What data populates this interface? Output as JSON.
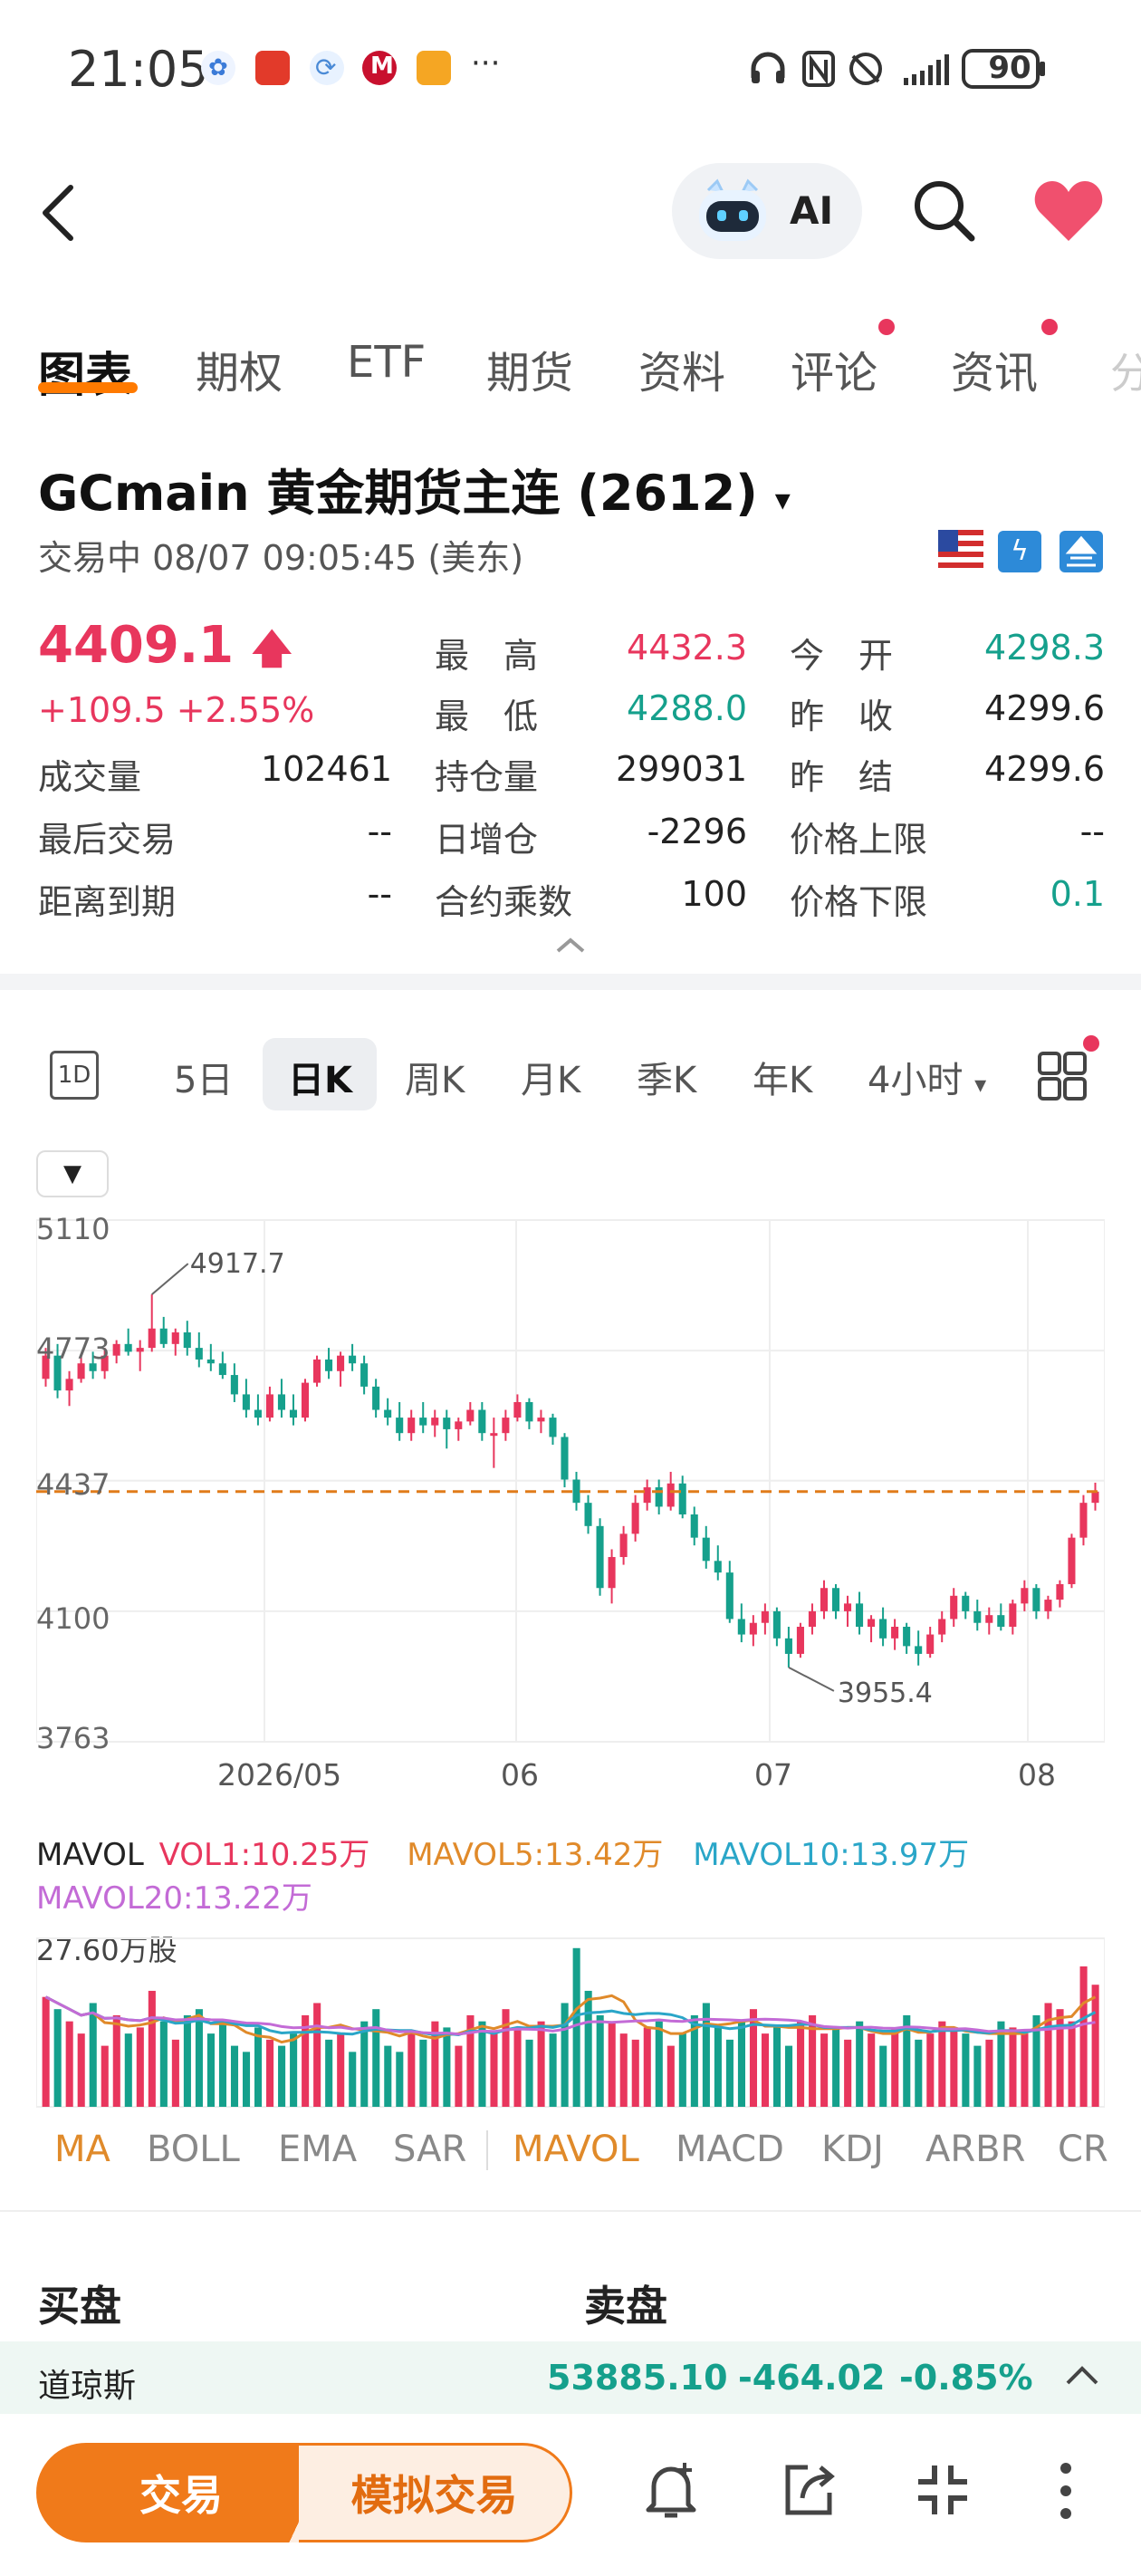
{
  "status_bar": {
    "time": "21:05",
    "more": "···",
    "battery": "90"
  },
  "header": {
    "ai_label": "AI"
  },
  "tabs": [
    "图表",
    "期权",
    "ETF",
    "期货",
    "资料",
    "评论",
    "资讯"
  ],
  "instrument": {
    "title": "GCmain  黄金期货主连 (2612)",
    "status": "交易中   08/07 09:05:45 (美东)"
  },
  "quote": {
    "price": "4409.1",
    "change": "+109.5  +2.55%",
    "rows": [
      {
        "l1": "成交量",
        "v1": "102461",
        "l2": "持仓量",
        "v2": "299031",
        "l3": "昨　结",
        "v3": "4299.6"
      },
      {
        "l1": "最后交易",
        "v1": "--",
        "l2": "日增仓",
        "v2": "-2296",
        "l3": "价格上限",
        "v3": "--"
      },
      {
        "l1": "距离到期",
        "v1": "--",
        "l2": "合约乘数",
        "v2": "100",
        "l3": "价格下限",
        "v3": "0.1"
      }
    ],
    "high_label": "最　高",
    "high": "4432.3",
    "low_label": "最　低",
    "low": "4288.0",
    "open_label": "今　开",
    "open": "4298.3",
    "prev_close_label": "昨　收",
    "prev_close": "4299.6"
  },
  "periods": [
    "5日",
    "日K",
    "周K",
    "月K",
    "季K",
    "年K",
    "4小时"
  ],
  "chart_data": {
    "type": "candlestick",
    "y_ticks": [
      "5110",
      "4773",
      "4437",
      "4100",
      "3763"
    ],
    "x_ticks": [
      "2026/05",
      "06",
      "07",
      "08"
    ],
    "ylim": [
      3763,
      5110
    ],
    "high_annotation": "4917.7",
    "low_annotation": "3955.4",
    "reference_line": 4409.1,
    "candles": [
      [
        4700,
        4780,
        4680,
        4760
      ],
      [
        4760,
        4790,
        4650,
        4670
      ],
      [
        4670,
        4720,
        4630,
        4700
      ],
      [
        4700,
        4760,
        4690,
        4740
      ],
      [
        4740,
        4770,
        4700,
        4720
      ],
      [
        4720,
        4780,
        4700,
        4760
      ],
      [
        4760,
        4800,
        4740,
        4790
      ],
      [
        4790,
        4830,
        4760,
        4770
      ],
      [
        4770,
        4800,
        4720,
        4780
      ],
      [
        4780,
        4918,
        4770,
        4830
      ],
      [
        4830,
        4860,
        4780,
        4790
      ],
      [
        4790,
        4830,
        4760,
        4820
      ],
      [
        4820,
        4850,
        4760,
        4780
      ],
      [
        4780,
        4820,
        4730,
        4750
      ],
      [
        4750,
        4790,
        4720,
        4740
      ],
      [
        4740,
        4770,
        4700,
        4710
      ],
      [
        4710,
        4740,
        4640,
        4660
      ],
      [
        4660,
        4700,
        4600,
        4620
      ],
      [
        4620,
        4660,
        4580,
        4600
      ],
      [
        4600,
        4680,
        4590,
        4660
      ],
      [
        4660,
        4700,
        4600,
        4620
      ],
      [
        4620,
        4660,
        4580,
        4600
      ],
      [
        4600,
        4700,
        4590,
        4690
      ],
      [
        4690,
        4760,
        4680,
        4750
      ],
      [
        4750,
        4780,
        4700,
        4720
      ],
      [
        4720,
        4770,
        4680,
        4760
      ],
      [
        4760,
        4790,
        4720,
        4740
      ],
      [
        4740,
        4760,
        4660,
        4680
      ],
      [
        4680,
        4700,
        4600,
        4620
      ],
      [
        4620,
        4650,
        4580,
        4600
      ],
      [
        4600,
        4640,
        4540,
        4560
      ],
      [
        4560,
        4620,
        4540,
        4600
      ],
      [
        4600,
        4640,
        4560,
        4580
      ],
      [
        4580,
        4620,
        4550,
        4600
      ],
      [
        4600,
        4620,
        4520,
        4570
      ],
      [
        4570,
        4600,
        4540,
        4590
      ],
      [
        4590,
        4640,
        4580,
        4620
      ],
      [
        4620,
        4640,
        4540,
        4560
      ],
      [
        4560,
        4600,
        4470,
        4560
      ],
      [
        4560,
        4620,
        4540,
        4600
      ],
      [
        4600,
        4660,
        4590,
        4640
      ],
      [
        4640,
        4650,
        4570,
        4590
      ],
      [
        4590,
        4620,
        4560,
        4600
      ],
      [
        4600,
        4610,
        4530,
        4550
      ],
      [
        4550,
        4560,
        4420,
        4440
      ],
      [
        4440,
        4460,
        4360,
        4380
      ],
      [
        4380,
        4400,
        4300,
        4320
      ],
      [
        4320,
        4340,
        4140,
        4160
      ],
      [
        4160,
        4260,
        4120,
        4240
      ],
      [
        4240,
        4320,
        4220,
        4300
      ],
      [
        4300,
        4400,
        4280,
        4380
      ],
      [
        4380,
        4440,
        4360,
        4420
      ],
      [
        4420,
        4440,
        4350,
        4370
      ],
      [
        4370,
        4460,
        4360,
        4430
      ],
      [
        4430,
        4450,
        4340,
        4350
      ],
      [
        4350,
        4370,
        4270,
        4290
      ],
      [
        4290,
        4320,
        4210,
        4230
      ],
      [
        4230,
        4270,
        4180,
        4200
      ],
      [
        4200,
        4230,
        4070,
        4080
      ],
      [
        4080,
        4120,
        4020,
        4040
      ],
      [
        4040,
        4090,
        4010,
        4070
      ],
      [
        4070,
        4120,
        4040,
        4100
      ],
      [
        4100,
        4110,
        4010,
        4030
      ],
      [
        4030,
        4060,
        3955,
        3990
      ],
      [
        3990,
        4070,
        3980,
        4060
      ],
      [
        4060,
        4120,
        4040,
        4100
      ],
      [
        4100,
        4180,
        4080,
        4160
      ],
      [
        4160,
        4170,
        4080,
        4100
      ],
      [
        4100,
        4140,
        4060,
        4120
      ],
      [
        4120,
        4150,
        4040,
        4060
      ],
      [
        4060,
        4090,
        4020,
        4080
      ],
      [
        4080,
        4110,
        4010,
        4030
      ],
      [
        4030,
        4080,
        4000,
        4060
      ],
      [
        4060,
        4070,
        3990,
        4010
      ],
      [
        4010,
        4050,
        3960,
        3990
      ],
      [
        3990,
        4060,
        3980,
        4040
      ],
      [
        4040,
        4100,
        4020,
        4080
      ],
      [
        4080,
        4160,
        4060,
        4140
      ],
      [
        4140,
        4150,
        4080,
        4100
      ],
      [
        4100,
        4130,
        4050,
        4070
      ],
      [
        4070,
        4110,
        4040,
        4090
      ],
      [
        4090,
        4120,
        4050,
        4060
      ],
      [
        4060,
        4130,
        4040,
        4120
      ],
      [
        4120,
        4180,
        4100,
        4160
      ],
      [
        4160,
        4170,
        4080,
        4100
      ],
      [
        4100,
        4140,
        4080,
        4130
      ],
      [
        4130,
        4180,
        4110,
        4170
      ],
      [
        4170,
        4300,
        4160,
        4290
      ],
      [
        4290,
        4400,
        4270,
        4380
      ],
      [
        4380,
        4432,
        4360,
        4409
      ]
    ],
    "volume_label": "27.60万股",
    "mavol": {
      "title": "MAVOL",
      "vol1": "VOL1:10.25万",
      "mavol5": "MAVOL5:13.42万",
      "mavol10": "MAVOL10:13.97万",
      "mavol20": "MAVOL20:13.22万"
    },
    "volumes": [
      18,
      16,
      14,
      12,
      17,
      10,
      15,
      12,
      13,
      19,
      14,
      11,
      15,
      16,
      12,
      14,
      10,
      9,
      13,
      11,
      10,
      12,
      15,
      17,
      11,
      12,
      9,
      14,
      16,
      10,
      9,
      12,
      11,
      14,
      13,
      10,
      15,
      14,
      12,
      16,
      13,
      11,
      14,
      12,
      17,
      26,
      19,
      15,
      14,
      12,
      11,
      13,
      14,
      10,
      12,
      15,
      17,
      13,
      11,
      14,
      16,
      12,
      13,
      10,
      14,
      15,
      12,
      13,
      11,
      14,
      12,
      10,
      13,
      15,
      11,
      12,
      14,
      13,
      12,
      10,
      11,
      14,
      13,
      12,
      15,
      17,
      16,
      14,
      23,
      20
    ],
    "ma_lines": {
      "colors": [
        "#e08a2a",
        "#2aa6c8",
        "#c36bd6"
      ]
    }
  },
  "indicators": [
    "MA",
    "BOLL",
    "EMA",
    "SAR",
    "MAVOL",
    "MACD",
    "KDJ",
    "ARBR",
    "CR"
  ],
  "order_book": {
    "buy": "买盘",
    "sell": "卖盘"
  },
  "ticker": {
    "name": "道琼斯",
    "price": "53885.10",
    "change": "-464.02",
    "pct": "-0.85%"
  },
  "bottom_bar": {
    "trade": "交易",
    "simulate": "模拟交易"
  },
  "colors": {
    "up": "#e8365d",
    "down": "#15a08c",
    "accent": "#f07a1a"
  }
}
